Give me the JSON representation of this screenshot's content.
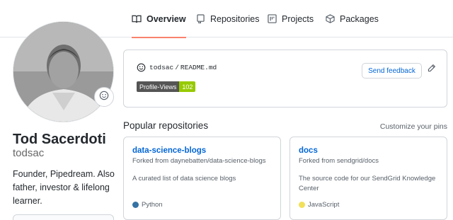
{
  "tabs": [
    {
      "label": "Overview",
      "icon": "book-icon",
      "active": true
    },
    {
      "label": "Repositories",
      "icon": "repo-icon",
      "active": false
    },
    {
      "label": "Projects",
      "icon": "project-icon",
      "active": false
    },
    {
      "label": "Packages",
      "icon": "package-icon",
      "active": false
    }
  ],
  "profile": {
    "fullname": "Tod Sacerdoti",
    "username": "todsac",
    "bio": "Founder, Pipedream. Also father, investor & lifelong learner."
  },
  "readme": {
    "user": "todsac",
    "separator": "/",
    "file": "README.md",
    "badge_label": "Profile-Views",
    "badge_value": "102",
    "feedback_label": "Send feedback"
  },
  "popular": {
    "title": "Popular repositories",
    "customize_label": "Customize your pins"
  },
  "repos": [
    {
      "name": "data-science-blogs",
      "fork_text": "Forked from daynebatten/data-science-blogs",
      "description": "A curated list of data science blogs",
      "language": "Python",
      "language_color": "#3572A5"
    },
    {
      "name": "docs",
      "fork_text": "Forked from sendgrid/docs",
      "description": "The source code for our SendGrid Knowledge Center",
      "language": "JavaScript",
      "language_color": "#f1e05a"
    }
  ],
  "colors": {
    "accent": "#0366d6",
    "tab_underline": "#f9826c",
    "badge_value_bg": "#97ca00"
  }
}
